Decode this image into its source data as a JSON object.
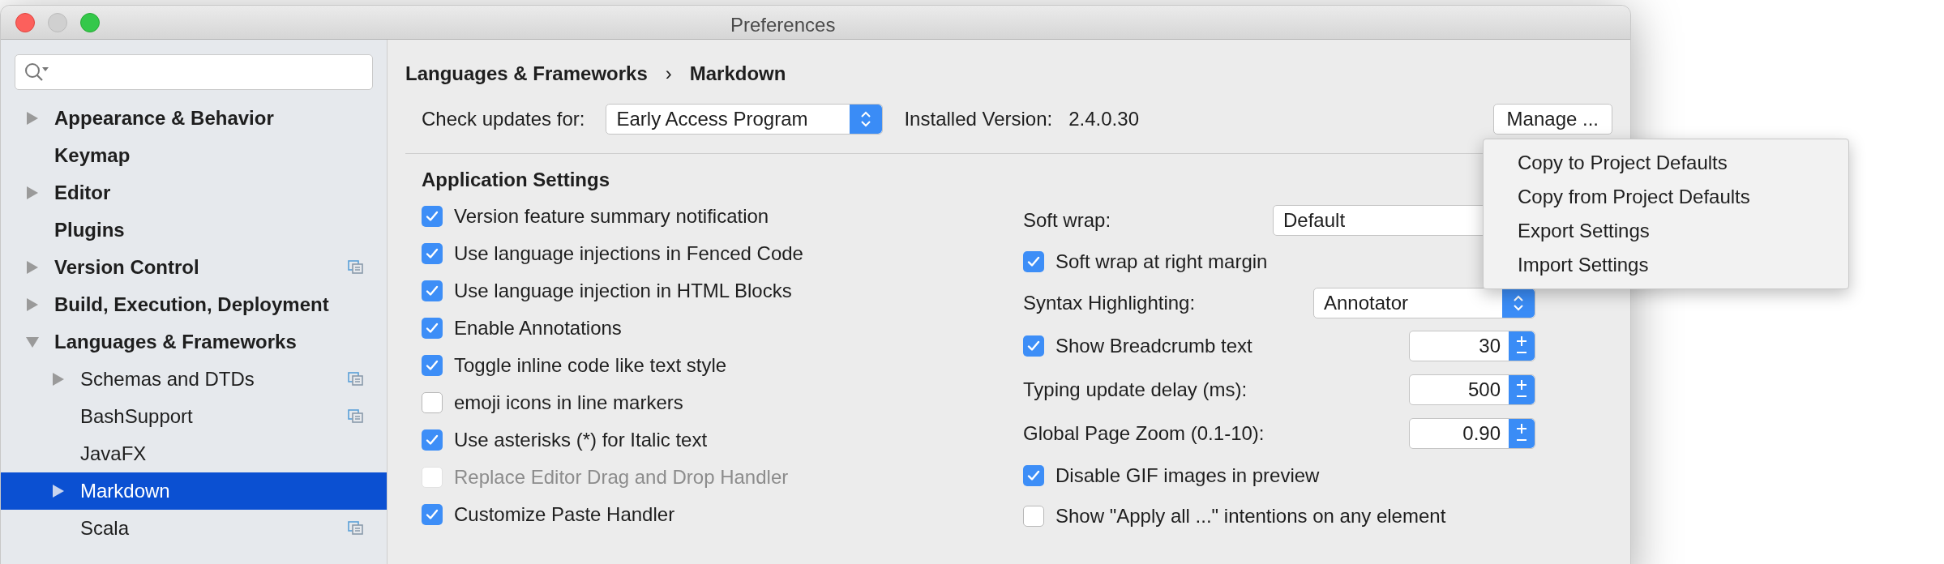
{
  "window": {
    "title": "Preferences"
  },
  "sidebar": {
    "items": [
      {
        "label": "Appearance & Behavior",
        "expanded": false,
        "selected": false,
        "project_icon": false
      },
      {
        "label": "Keymap",
        "selected": false,
        "project_icon": false
      },
      {
        "label": "Editor",
        "expanded": false,
        "selected": false,
        "project_icon": false
      },
      {
        "label": "Plugins",
        "selected": false,
        "project_icon": false
      },
      {
        "label": "Version Control",
        "expanded": false,
        "selected": false,
        "project_icon": true
      },
      {
        "label": "Build, Execution, Deployment",
        "expanded": false,
        "selected": false,
        "project_icon": false
      },
      {
        "label": "Languages & Frameworks",
        "expanded": true,
        "selected": false,
        "project_icon": false,
        "children": [
          {
            "label": "Schemas and DTDs",
            "expanded": false,
            "selected": false,
            "project_icon": true
          },
          {
            "label": "BashSupport",
            "selected": false,
            "project_icon": true
          },
          {
            "label": "JavaFX",
            "selected": false,
            "project_icon": false
          },
          {
            "label": "Markdown",
            "expanded": false,
            "selected": true,
            "project_icon": false
          },
          {
            "label": "Scala",
            "selected": false,
            "project_icon": true
          }
        ]
      }
    ]
  },
  "breadcrumb": {
    "items": [
      "Languages & Frameworks",
      "Markdown"
    ],
    "separator": "›"
  },
  "updates": {
    "label": "Check updates for:",
    "value": "Early Access Program"
  },
  "installed": {
    "label": "Installed Version:",
    "value": "2.4.0.30"
  },
  "manage_button": "Manage ...",
  "manage_menu": [
    "Copy to Project Defaults",
    "Copy from Project Defaults",
    "Export Settings",
    "Import Settings"
  ],
  "section_title": "Application Settings",
  "left_options": [
    {
      "label": "Version feature summary notification",
      "checked": true,
      "disabled": false
    },
    {
      "label": "Use language injections in Fenced Code",
      "checked": true,
      "disabled": false
    },
    {
      "label": "Use language injection in HTML Blocks",
      "checked": true,
      "disabled": false
    },
    {
      "label": "Enable Annotations",
      "checked": true,
      "disabled": false
    },
    {
      "label": "Toggle inline code like text style",
      "checked": true,
      "disabled": false
    },
    {
      "label": "emoji icons in line markers",
      "checked": false,
      "disabled": false
    },
    {
      "label": "Use asterisks (*) for Italic text",
      "checked": true,
      "disabled": false
    },
    {
      "label": "Replace Editor Drag and Drop Handler",
      "checked": false,
      "disabled": true
    },
    {
      "label": "Customize Paste Handler",
      "checked": true,
      "disabled": false
    }
  ],
  "right_settings": [
    {
      "kind": "select",
      "label": "Soft wrap:",
      "value": "Default"
    },
    {
      "kind": "checkbox",
      "label": "Soft wrap at right margin",
      "checked": true
    },
    {
      "kind": "select",
      "label": "Syntax Highlighting:",
      "value": "Annotator"
    },
    {
      "kind": "checkbox_number",
      "label": "Show Breadcrumb text",
      "checked": true,
      "value": "30"
    },
    {
      "kind": "number",
      "label": "Typing update delay (ms):",
      "value": "500"
    },
    {
      "kind": "number",
      "label": "Global Page Zoom (0.1-10):",
      "value": "0.90"
    },
    {
      "kind": "checkbox",
      "label": "Disable GIF images in preview",
      "checked": true
    },
    {
      "kind": "checkbox",
      "label": "Show \"Apply all ...\" intentions on any element",
      "checked": false
    }
  ]
}
